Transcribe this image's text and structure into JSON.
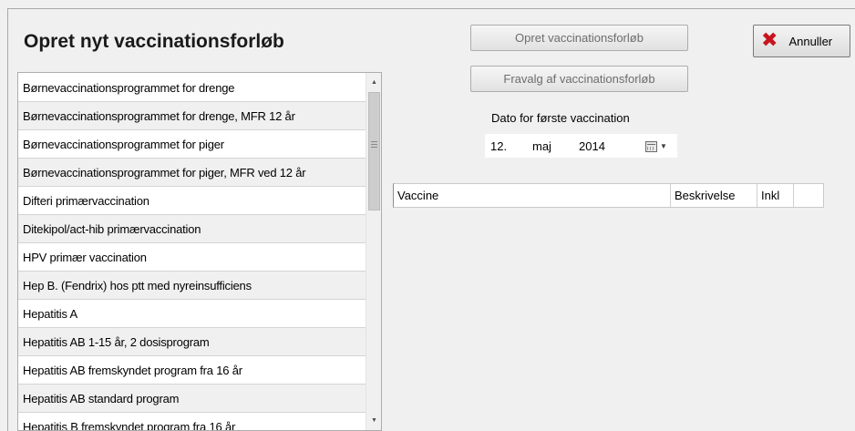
{
  "window": {
    "title": "Opret nyt vaccinationsforløb"
  },
  "list": {
    "items": [
      "Børnevaccinationsprogrammet for drenge",
      "Børnevaccinationsprogrammet for drenge, MFR 12 år",
      "Børnevaccinationsprogrammet for piger",
      "Børnevaccinationsprogrammet for piger, MFR ved 12 år",
      "Difteri primærvaccination",
      "Ditekipol/act-hib primærvaccination",
      "HPV primær vaccination",
      "Hep B. (Fendrix) hos ptt med nyreinsufficiens",
      "Hepatitis A",
      "Hepatitis AB 1-15 år, 2 dosisprogram",
      "Hepatitis AB fremskyndet program fra 16 år",
      "Hepatitis AB standard program",
      "Hepatitis B fremskyndet program fra 16 år"
    ]
  },
  "buttons": {
    "create_label": "Opret vaccinationsforløb",
    "deselect_label": "Fravalg af vaccinationsforløb",
    "cancel_label": "Annuller"
  },
  "date": {
    "label": "Dato for første vaccination",
    "day": "12.",
    "month": "maj",
    "year": "2014"
  },
  "grid": {
    "columns": [
      "Vaccine",
      "Beskrivelse",
      "Inkl"
    ]
  },
  "colors": {
    "cancel_icon": "#c8141e",
    "background": "#f0f0f0",
    "disabled_text": "#6d6d6d"
  },
  "icons": {
    "cancel": "close-x-icon",
    "calendar": "calendar-icon",
    "dropdown": "chevron-down-icon"
  }
}
